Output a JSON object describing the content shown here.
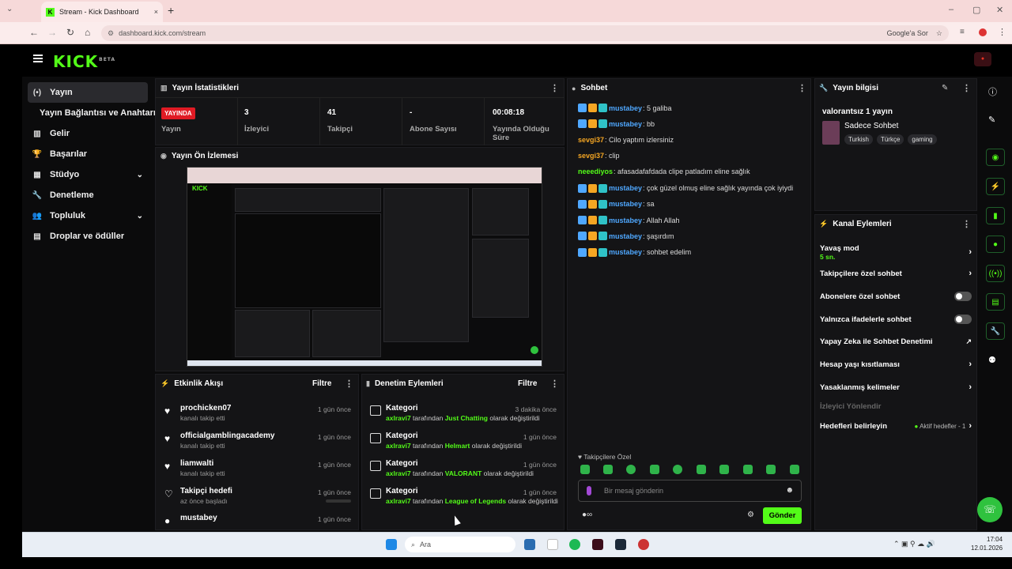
{
  "browser": {
    "tab_title": "Stream - Kick Dashboard",
    "tab_close": "×",
    "new_tab": "+",
    "url": "dashboard.kick.com/stream",
    "google_btn": "Google'a Sor",
    "win_min": "–",
    "win_max": "▢",
    "win_close": "✕",
    "back": "←",
    "forward": "→",
    "reload": "↻",
    "home": "⌂"
  },
  "brand": {
    "logo": "KICK",
    "beta": "BETA",
    "accent": "#53fc18"
  },
  "sidebar": {
    "items": [
      {
        "label": "Yayın",
        "icon": "(•)"
      },
      {
        "label": "Yayın Bağlantısı ve Anahtarı"
      },
      {
        "label": "Gelir",
        "icon": "▥"
      },
      {
        "label": "Başarılar",
        "icon": "🏆"
      },
      {
        "label": "Stüdyo",
        "icon": "▦"
      },
      {
        "label": "Denetleme",
        "icon": "🔧"
      },
      {
        "label": "Topluluk",
        "icon": "👥"
      },
      {
        "label": "Droplar ve ödüller",
        "icon": "▤"
      }
    ]
  },
  "stats": {
    "title": "Yayın İstatistikleri",
    "live_badge": "YAYINDA",
    "live_label": "Yayın",
    "viewers_value": "3",
    "viewers_label": "İzleyici",
    "followers_value": "41",
    "followers_label": "Takipçi",
    "subs_value": "-",
    "subs_label": "Abone Sayısı",
    "uptime_value": "00:08:18",
    "uptime_label": "Yayında Olduğu Süre"
  },
  "preview": {
    "title": "Yayın Ön İzlemesi"
  },
  "activity": {
    "title": "Etkinlik Akışı",
    "filter": "Filtre",
    "items": [
      {
        "name": "prochicken07",
        "sub": "kanalı takip etti",
        "time": "1 gün önce"
      },
      {
        "name": "officialgamblingacademy",
        "sub": "kanalı takip etti",
        "time": "1 gün önce"
      },
      {
        "name": "liamwalti",
        "sub": "kanalı takip etti",
        "time": "1 gün önce"
      },
      {
        "name": "Takipçi hedefi",
        "sub": "az önce başladı",
        "time": "1 gün önce"
      },
      {
        "name": "mustabey",
        "sub": "",
        "time": "1 gün önce"
      }
    ]
  },
  "moderation": {
    "title": "Denetim Eylemleri",
    "filter": "Filtre",
    "items": [
      {
        "name": "Kategori",
        "user": "axlravi7",
        "mid": " tarafından ",
        "cat": "Just Chatting",
        "end": " olarak değiştirildi",
        "time": "3 dakika önce"
      },
      {
        "name": "Kategori",
        "user": "axlravi7",
        "mid": " tarafından ",
        "cat": "Helmart",
        "end": " olarak değiştirildi",
        "time": "1 gün önce"
      },
      {
        "name": "Kategori",
        "user": "axlravi7",
        "mid": " tarafından ",
        "cat": "VALORANT",
        "end": " olarak değiştirildi",
        "time": "1 gün önce"
      },
      {
        "name": "Kategori",
        "user": "axlravi7",
        "mid": " tarafından ",
        "cat": "League of Legends",
        "end": " olarak değiştirildi",
        "time": "1 gün önce"
      }
    ]
  },
  "chat": {
    "title": "Sohbet",
    "messages": [
      {
        "user": "mustabey",
        "text": ": 5 galiba",
        "color": "#4fa8ff",
        "badges": true
      },
      {
        "user": "mustabey",
        "text": ": bb",
        "color": "#4fa8ff",
        "badges": true
      },
      {
        "user": "sevgi37",
        "text": ": Cilo yaptım izlersiniz",
        "color": "#f5a623",
        "badges": false
      },
      {
        "user": "sevgi37",
        "text": ": clip",
        "color": "#f5a623",
        "badges": false
      },
      {
        "user": "neeediyos",
        "text": ": afasadafafdada clipe patladım eline sağlık",
        "color": "#53fc18",
        "badges": false
      },
      {
        "user": "mustabey",
        "text": ": çok güzel olmuş eline sağlık yayında çok iyiydi",
        "color": "#4fa8ff",
        "badges": true
      },
      {
        "user": "mustabey",
        "text": ": sa",
        "color": "#4fa8ff",
        "badges": true
      },
      {
        "user": "mustabey",
        "text": ": Allah Allah",
        "color": "#4fa8ff",
        "badges": true
      },
      {
        "user": "mustabey",
        "text": ": şaşırdım",
        "color": "#4fa8ff",
        "badges": true
      },
      {
        "user": "mustabey",
        "text": ": sohbet edelim",
        "color": "#4fa8ff",
        "badges": true
      }
    ],
    "followers_only": "Takipçilere Özel",
    "input_placeholder": "Bir mesaj gönderin",
    "send": "Gönder"
  },
  "stream_info": {
    "title": "Yayın bilgisi",
    "stream_title": "valorantsız 1 yayın",
    "category": "Sadece Sohbet",
    "tags": [
      "Turkish",
      "Türkçe",
      "gaming"
    ]
  },
  "channel_actions": {
    "title": "Kanal Eylemleri",
    "slow_mode": "Yavaş mod",
    "slow_mode_value": "5 sn.",
    "followers_chat": "Takipçilere özel sohbet",
    "subs_chat": "Abonelere özel sohbet",
    "emote_chat": "Yalnızca ifadelerle sohbet",
    "ai_mod": "Yapay Zeka ile Sohbet Denetimi",
    "age_restrict": "Hesap yaşı kısıtlaması",
    "banned_words": "Yasaklanmış kelimeler",
    "raid": "İzleyici Yönlendir",
    "goals": "Hedefleri belirleyin",
    "goals_status": "Aktif hedefler - 1"
  },
  "taskbar": {
    "search": "Ara",
    "time": "17:04",
    "date": "12.01.2026"
  }
}
